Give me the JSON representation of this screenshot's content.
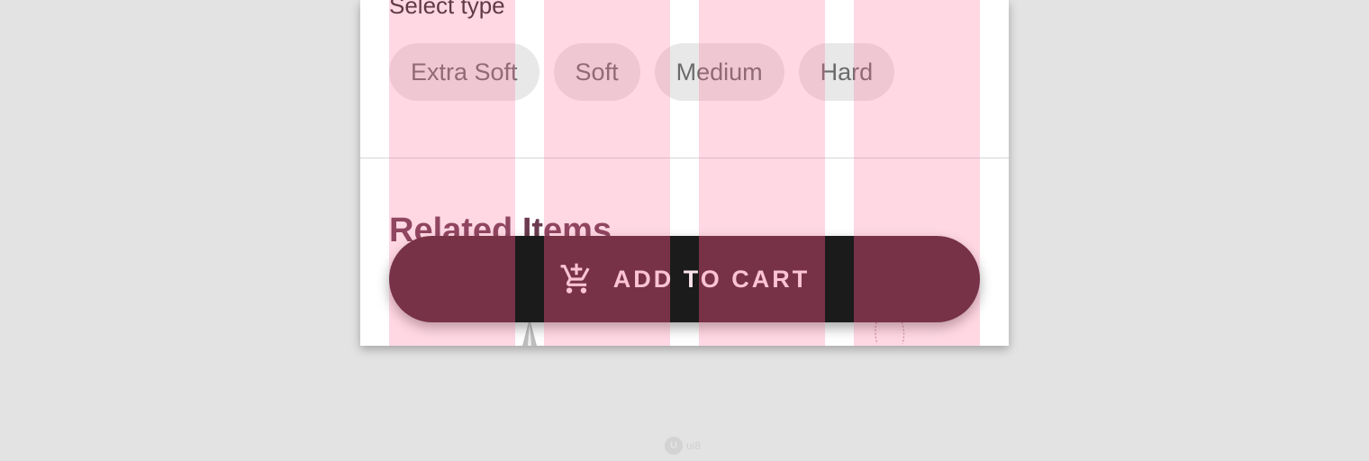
{
  "type_section": {
    "title": "Select type",
    "chips": [
      {
        "label": "Extra Soft"
      },
      {
        "label": "Soft"
      },
      {
        "label": "Medium"
      },
      {
        "label": "Hard"
      }
    ]
  },
  "related": {
    "title": "Related Items"
  },
  "fab": {
    "icon": "add-shopping-cart-icon",
    "label": "ADD TO CART"
  },
  "watermark": {
    "icon": "ui8-logo-icon",
    "text": "ui8"
  },
  "colors": {
    "background": "#e3e3e3",
    "card": "#ffffff",
    "chip_bg": "#e8e8e8",
    "chip_text": "#6b6b6b",
    "fab_bg": "#48202d",
    "fab_text": "#fbe3ea",
    "related_title": "#6a3a4e",
    "grid_overlay": "rgba(255,105,150,0.26)"
  }
}
